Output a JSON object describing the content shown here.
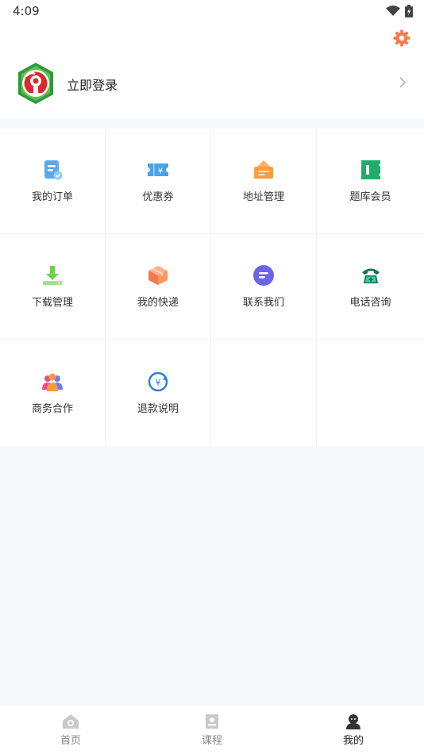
{
  "status_bar": {
    "time": "4:09",
    "icons": [
      "wifi-icon",
      "battery-icon"
    ]
  },
  "header": {
    "settings_icon": "gear-icon",
    "login_label": "立即登录",
    "accent_color": "#f47b4f"
  },
  "menu": {
    "items": [
      {
        "label": "我的订单",
        "icon": "order-icon"
      },
      {
        "label": "优惠券",
        "icon": "coupon-icon"
      },
      {
        "label": "地址管理",
        "icon": "address-icon"
      },
      {
        "label": "题库会员",
        "icon": "membership-icon"
      },
      {
        "label": "下载管理",
        "icon": "download-icon"
      },
      {
        "label": "我的快递",
        "icon": "package-icon"
      },
      {
        "label": "联系我们",
        "icon": "chat-icon"
      },
      {
        "label": "电话咨询",
        "icon": "phone-icon"
      },
      {
        "label": "商务合作",
        "icon": "partners-icon"
      },
      {
        "label": "退款说明",
        "icon": "refund-icon"
      }
    ]
  },
  "tabbar": {
    "tabs": [
      {
        "label": "首页",
        "icon": "home-icon",
        "active": false
      },
      {
        "label": "课程",
        "icon": "course-icon",
        "active": false
      },
      {
        "label": "我的",
        "icon": "profile-icon",
        "active": true
      }
    ]
  }
}
